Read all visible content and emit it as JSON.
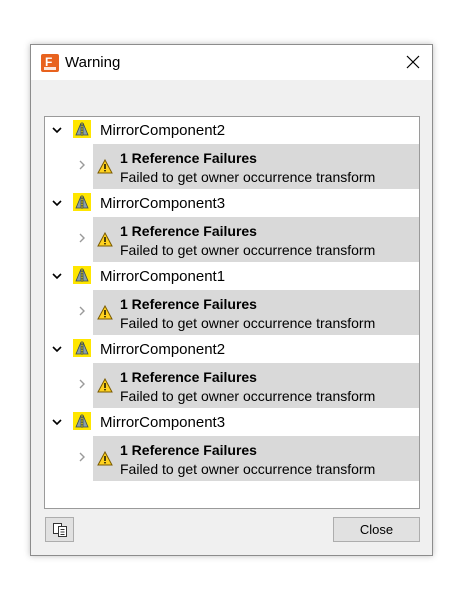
{
  "window": {
    "title": "Warning",
    "icon": "fusion-app-icon",
    "close_icon": "close-icon"
  },
  "tree": {
    "groups": [
      {
        "component": "MirrorComponent2",
        "child": {
          "title": "1 Reference Failures",
          "message": "Failed to get owner occurrence transform"
        }
      },
      {
        "component": "MirrorComponent3",
        "child": {
          "title": "1 Reference Failures",
          "message": "Failed to get owner occurrence transform"
        }
      },
      {
        "component": "MirrorComponent1",
        "child": {
          "title": "1 Reference Failures",
          "message": "Failed to get owner occurrence transform"
        }
      },
      {
        "component": "MirrorComponent2",
        "child": {
          "title": "1 Reference Failures",
          "message": "Failed to get owner occurrence transform"
        }
      },
      {
        "component": "MirrorComponent3",
        "child": {
          "title": "1 Reference Failures",
          "message": "Failed to get owner occurrence transform"
        }
      }
    ]
  },
  "footer": {
    "copy_icon": "copy-icon",
    "close_label": "Close"
  },
  "colors": {
    "app_icon": "#e8621e",
    "mirror_icon_bg": "#ffe600",
    "child_bg": "#d9d9d9",
    "warning_yellow": "#ffd21f"
  }
}
